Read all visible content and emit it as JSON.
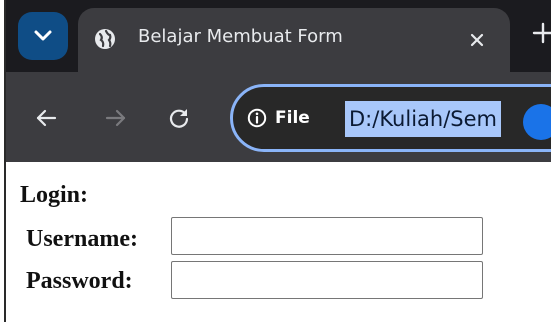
{
  "browser": {
    "tab": {
      "title": "Belajar Membuat Form"
    },
    "address_bar": {
      "site_info_label": "File",
      "url": "D:/Kuliah/Sem"
    },
    "icons": {
      "tab_menu": "chevron-down-icon",
      "favicon": "globe-icon",
      "close": "close-icon",
      "new_tab": "plus-icon",
      "back": "arrow-left-icon",
      "forward": "arrow-right-icon",
      "reload": "reload-icon",
      "site_info": "info-icon"
    },
    "colors": {
      "tab_strip": "#1b1b1f",
      "toolbar": "#3c3c40",
      "accent": "#8ab4f8",
      "selection": "#a8c7fa",
      "tab_menu_button": "#0f4d86"
    }
  },
  "page": {
    "heading": "Login:",
    "fields": {
      "username_label": "Username:",
      "username_value": "",
      "password_label": "Password:",
      "password_value": ""
    }
  }
}
